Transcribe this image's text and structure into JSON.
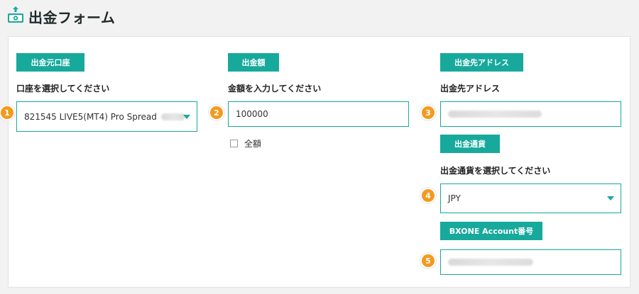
{
  "header": {
    "title": "出金フォーム",
    "icon": "money-withdraw-icon"
  },
  "form": {
    "source_account": {
      "tag": "出金元口座",
      "label": "口座を選択してください",
      "value": "821545 LIVE5(MT4) Pro Spread",
      "marker": "1"
    },
    "amount": {
      "tag": "出金額",
      "label": "金額を入力してください",
      "value": "100000",
      "marker": "2",
      "full_amount_label": "全額",
      "full_amount_checked": false
    },
    "address": {
      "tag": "出金先アドレス",
      "label": "出金先アドレス",
      "marker": "3"
    },
    "currency": {
      "tag": "出金通貨",
      "label": "出金通貨を選択してください",
      "value": "JPY",
      "marker": "4"
    },
    "bxone": {
      "tag": "BXONE Account番号",
      "marker": "5"
    }
  },
  "colors": {
    "accent": "#17a99c",
    "marker": "#f39a1e",
    "background": "#f2f2f2"
  }
}
